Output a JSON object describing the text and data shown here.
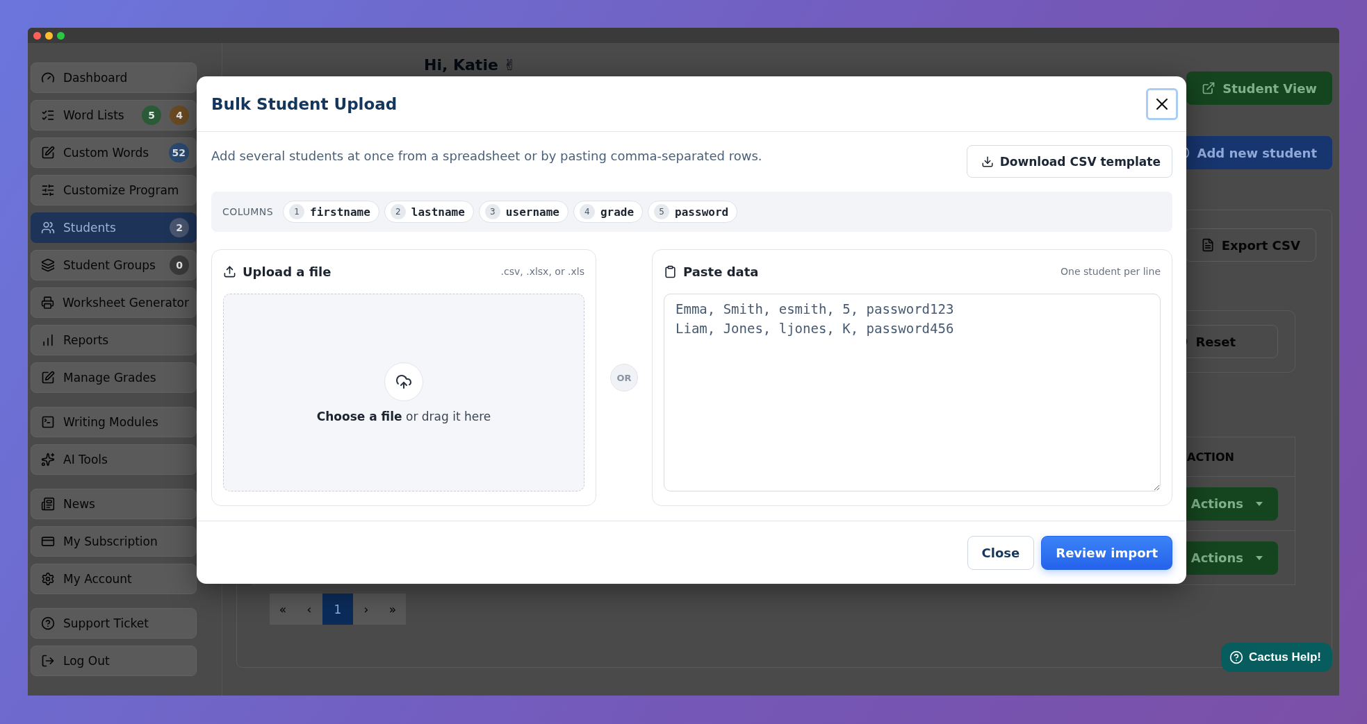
{
  "sidebar": {
    "groups": [
      {
        "items": [
          {
            "label": "Dashboard",
            "selected": false
          },
          {
            "label": "Word Lists",
            "selected": false,
            "badges": [
              {
                "text": "5",
                "color": "#2a5a36"
              },
              {
                "text": "4",
                "color": "#6a4a22"
              }
            ]
          },
          {
            "label": "Custom Words",
            "selected": false,
            "badges": [
              {
                "text": "52",
                "color": "#2b4a72"
              }
            ]
          },
          {
            "label": "Customize Program",
            "selected": false
          },
          {
            "label": "Students",
            "selected": true,
            "badges": [
              {
                "text": "2",
                "color": "#4a5670"
              }
            ]
          },
          {
            "label": "Student Groups",
            "selected": false,
            "badges": [
              {
                "text": "0",
                "color": "#3a3a3a"
              }
            ]
          },
          {
            "label": "Worksheet Generator",
            "selected": false
          },
          {
            "label": "Reports",
            "selected": false
          },
          {
            "label": "Manage Grades",
            "selected": false
          }
        ]
      },
      {
        "items": [
          {
            "label": "Writing Modules",
            "selected": false
          },
          {
            "label": "AI Tools",
            "selected": false
          }
        ]
      },
      {
        "items": [
          {
            "label": "News",
            "selected": false
          },
          {
            "label": "My Subscription",
            "selected": false
          },
          {
            "label": "My Account",
            "selected": false
          }
        ]
      },
      {
        "items": [
          {
            "label": "Support Ticket",
            "selected": false
          },
          {
            "label": "Log Out",
            "selected": false
          }
        ]
      }
    ]
  },
  "header": {
    "greeting": "Hi, Katie ✌",
    "student_view_button": "Student View",
    "add_student_button": "Add new student"
  },
  "content": {
    "export_button": "Export CSV",
    "reset_button": "Reset",
    "table": {
      "columns": [
        "ACTION"
      ],
      "rows": [
        {
          "action": "Actions"
        },
        {
          "action": "Actions"
        }
      ]
    },
    "pagination": [
      {
        "label": "«",
        "selected": false
      },
      {
        "label": "‹",
        "selected": false
      },
      {
        "label": "1",
        "selected": true
      },
      {
        "label": "›",
        "selected": false
      },
      {
        "label": "»",
        "selected": false
      }
    ]
  },
  "modal": {
    "title": "Bulk Student Upload",
    "close_button": {
      "focused": true
    },
    "description": "Add several students at once from a spreadsheet or by pasting comma-separated rows.",
    "template_button": "Download CSV template",
    "columns_label": "COLUMNS",
    "columns": [
      {
        "index": "1",
        "name": "firstname"
      },
      {
        "index": "2",
        "name": "lastname"
      },
      {
        "index": "3",
        "name": "username"
      },
      {
        "index": "4",
        "name": "grade"
      },
      {
        "index": "5",
        "name": "password"
      }
    ],
    "upload": {
      "title": "Upload a file",
      "hint": ".csv, .xlsx, or .xls",
      "prompt": "**Choose a file** or drag it here"
    },
    "divider": "OR",
    "paste": {
      "title": "Paste data",
      "hint": "One student per line",
      "value": "Emma, Smith, esmith, 5, password123\nLiam, Jones, ljones, K, password456"
    },
    "buttons": [
      {
        "label": "Close",
        "kind": "secondary"
      },
      {
        "label": "Review import",
        "kind": "primary"
      }
    ]
  },
  "help_button": "Cactus Help!"
}
